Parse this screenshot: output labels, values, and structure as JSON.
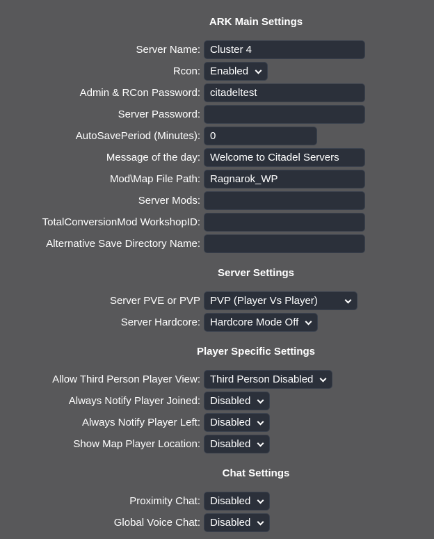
{
  "colors": {
    "page_bg": "#58585a",
    "field_bg": "#2b303a",
    "field_border": "#3a414d",
    "text": "#ffffff"
  },
  "sections": [
    {
      "title": "ARK Main Settings",
      "rows": [
        {
          "label": "Server Name:",
          "type": "text",
          "value": "Cluster 4"
        },
        {
          "label": "Rcon:",
          "type": "select",
          "value": "Enabled"
        },
        {
          "label": "Admin & RCon Password:",
          "type": "text",
          "value": "citadeltest"
        },
        {
          "label": "Server Password:",
          "type": "text",
          "value": ""
        },
        {
          "label": "AutoSavePeriod (Minutes):",
          "type": "text",
          "value": "0",
          "size": "short"
        },
        {
          "label": "Message of the day:",
          "type": "text",
          "value": "Welcome to Citadel Servers"
        },
        {
          "label": "Mod\\Map File Path:",
          "type": "text",
          "value": "Ragnarok_WP"
        },
        {
          "label": "Server Mods:",
          "type": "text",
          "value": ""
        },
        {
          "label": "TotalConversionMod WorkshopID:",
          "type": "text",
          "value": ""
        },
        {
          "label": "Alternative Save Directory Name:",
          "type": "text",
          "value": ""
        }
      ]
    },
    {
      "title": "Server Settings",
      "rows": [
        {
          "label": "Server PVE or PVP",
          "type": "select",
          "value": "PVP (Player Vs Player)",
          "size": "fixed"
        },
        {
          "label": "Server Hardcore:",
          "type": "select",
          "value": "Hardcore Mode Off"
        }
      ]
    },
    {
      "title": "Player Specific Settings",
      "rows": [
        {
          "label": "Allow Third Person Player View:",
          "type": "select",
          "value": "Third Person Disabled"
        },
        {
          "label": "Always Notify Player Joined:",
          "type": "select",
          "value": "Disabled"
        },
        {
          "label": "Always Notify Player Left:",
          "type": "select",
          "value": "Disabled"
        },
        {
          "label": "Show Map Player Location:",
          "type": "select",
          "value": "Disabled"
        }
      ]
    },
    {
      "title": "Chat Settings",
      "rows": [
        {
          "label": "Proximity Chat:",
          "type": "select",
          "value": "Disabled"
        },
        {
          "label": "Global Voice Chat:",
          "type": "select",
          "value": "Disabled"
        }
      ]
    }
  ]
}
